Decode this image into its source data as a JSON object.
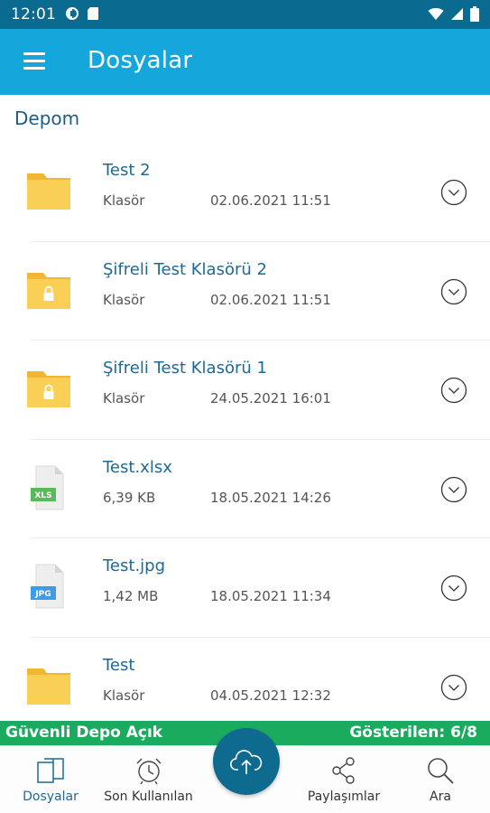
{
  "status_bar": {
    "time": "12:01"
  },
  "app_bar": {
    "title": "Dosyalar"
  },
  "breadcrumb": "Depom",
  "files": [
    {
      "name": "Test 2",
      "type": "Klasör",
      "date": "02.06.2021 11:51",
      "icon": "folder-icon"
    },
    {
      "name": "Şifreli Test Klasörü 2",
      "type": "Klasör",
      "date": "02.06.2021 11:51",
      "icon": "locked-folder-icon"
    },
    {
      "name": "Şifreli Test Klasörü 1",
      "type": "Klasör",
      "date": "24.05.2021 16:01",
      "icon": "locked-folder-icon"
    },
    {
      "name": "Test.xlsx",
      "type": "6,39 KB",
      "date": "18.05.2021 14:26",
      "icon": "xls-file-icon",
      "badge": "XLS"
    },
    {
      "name": "Test.jpg",
      "type": "1,42 MB",
      "date": "18.05.2021 11:34",
      "icon": "jpg-file-icon",
      "badge": "JPG"
    },
    {
      "name": "Test",
      "type": "Klasör",
      "date": "04.05.2021 12:32",
      "icon": "folder-icon"
    }
  ],
  "depo_bar": {
    "left": "Güvenli Depo Açık",
    "right": "Gösterilen: 6/8"
  },
  "bottom_nav": [
    {
      "label": "Dosyalar",
      "icon": "files-icon",
      "active": true
    },
    {
      "label": "Son Kullanılan",
      "icon": "alarm-clock-icon"
    },
    {
      "label": "Paylaşımlar",
      "icon": "share-icon"
    },
    {
      "label": "Ara",
      "icon": "search-icon"
    }
  ],
  "fab": {
    "icon": "cloud-upload-icon"
  },
  "colors": {
    "status_bar": "#0a6a8f",
    "app_bar": "#15a6dc",
    "accent_text": "#1c6a95",
    "folder": "#f7c948",
    "depo_bar": "#1aab5e",
    "fab": "#0e6b8f",
    "xls_badge": "#4caf50",
    "jpg_badge": "#2196f3"
  }
}
